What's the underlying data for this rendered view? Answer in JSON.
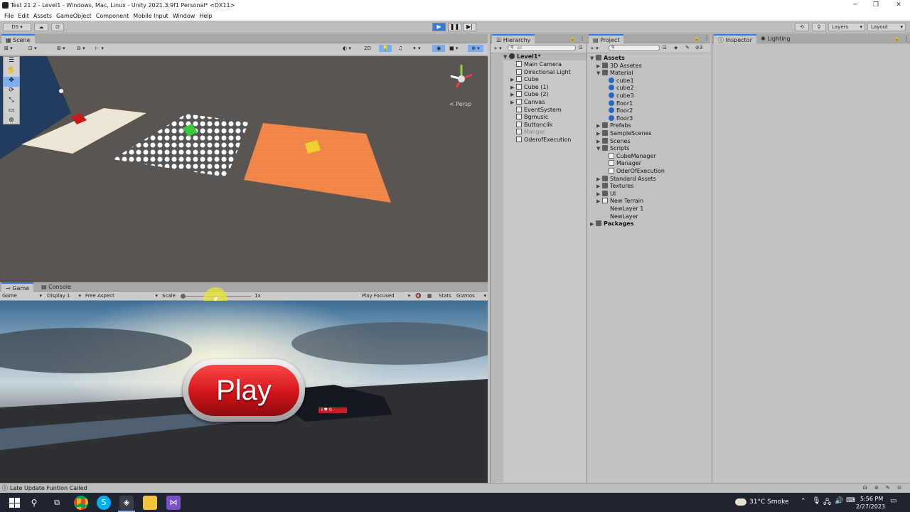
{
  "window": {
    "title": "Test 21 2 - Level1 - Windows, Mac, Linux - Unity 2021.3.9f1 Personal* <DX11>"
  },
  "menu": [
    "File",
    "Edit",
    "Assets",
    "GameObject",
    "Component",
    "Mobile Input",
    "Window",
    "Help"
  ],
  "toolbar": {
    "account": "DS",
    "layers": "Layers",
    "layout": "Layout"
  },
  "scene": {
    "tab": "Scene",
    "mode2d": "2D",
    "persp": "< Persp"
  },
  "game": {
    "tabs": [
      "Game",
      "Console"
    ],
    "mode": "Game",
    "display": "Display 1",
    "aspect": "Free Aspect",
    "scale_label": "Scale",
    "scale_value": "1x",
    "play_focused": "Play Focused",
    "stats": "Stats",
    "gizmos": "Gizmos",
    "play_button": "Play",
    "car_plate": "I ♥ 0"
  },
  "hierarchy": {
    "tab": "Hierarchy",
    "search_placeholder": "All",
    "root": "Level1*",
    "items": [
      {
        "label": "Main Camera",
        "arrow": ""
      },
      {
        "label": "Directional Light",
        "arrow": ""
      },
      {
        "label": "Cube",
        "arrow": "▶"
      },
      {
        "label": "Cube (1)",
        "arrow": "▶"
      },
      {
        "label": "Cube (2)",
        "arrow": "▶"
      },
      {
        "label": "Canvas",
        "arrow": "▶"
      },
      {
        "label": "EventSystem",
        "arrow": ""
      },
      {
        "label": "Bgmusic",
        "arrow": ""
      },
      {
        "label": "Buttonclik",
        "arrow": ""
      },
      {
        "label": "Manger",
        "arrow": "",
        "disabled": true
      },
      {
        "label": "OderofExecution",
        "arrow": ""
      }
    ]
  },
  "project": {
    "tab": "Project",
    "count": "3",
    "tree": [
      {
        "label": "Assets",
        "arrow": "▼",
        "icon": "fold",
        "bold": true,
        "indent": 0
      },
      {
        "label": "3D Assetes",
        "arrow": "▶",
        "icon": "fold",
        "indent": 1
      },
      {
        "label": "Material",
        "arrow": "▼",
        "icon": "fold",
        "indent": 1
      },
      {
        "label": "cube1",
        "arrow": "",
        "icon": "mat",
        "indent": 2
      },
      {
        "label": "cube2",
        "arrow": "",
        "icon": "mat",
        "indent": 2
      },
      {
        "label": "cube3",
        "arrow": "",
        "icon": "mat",
        "indent": 2
      },
      {
        "label": "floor1",
        "arrow": "",
        "icon": "mat",
        "indent": 2
      },
      {
        "label": "floor2",
        "arrow": "",
        "icon": "mat",
        "indent": 2
      },
      {
        "label": "floor3",
        "arrow": "",
        "icon": "mat",
        "indent": 2
      },
      {
        "label": "Prefabs",
        "arrow": "▶",
        "icon": "fold",
        "indent": 1
      },
      {
        "label": "SampleScenes",
        "arrow": "▶",
        "icon": "fold",
        "indent": 1
      },
      {
        "label": "Scenes",
        "arrow": "▶",
        "icon": "fold",
        "indent": 1
      },
      {
        "label": "Scripts",
        "arrow": "▼",
        "icon": "fold",
        "indent": 1
      },
      {
        "label": "CubeManager",
        "arrow": "",
        "icon": "sc",
        "indent": 2
      },
      {
        "label": "Manager",
        "arrow": "",
        "icon": "sc",
        "indent": 2
      },
      {
        "label": "OderOfExecution",
        "arrow": "",
        "icon": "sc",
        "indent": 2
      },
      {
        "label": "Standard Assets",
        "arrow": "▶",
        "icon": "fold",
        "indent": 1
      },
      {
        "label": "Textures",
        "arrow": "▶",
        "icon": "fold",
        "indent": 1
      },
      {
        "label": "UI",
        "arrow": "▶",
        "icon": "fold",
        "indent": 1
      },
      {
        "label": "New Terrain",
        "arrow": "▶",
        "icon": "go",
        "indent": 1
      },
      {
        "label": "NewLayer 1",
        "arrow": "",
        "icon": "",
        "indent": 1
      },
      {
        "label": "NewLayer",
        "arrow": "",
        "icon": "",
        "indent": 1
      },
      {
        "label": "Packages",
        "arrow": "▶",
        "icon": "fold",
        "bold": true,
        "indent": 0
      }
    ]
  },
  "inspector": {
    "tabs": [
      "Inspector",
      "Lighting"
    ]
  },
  "status": {
    "message": "Late Update Funtion Called"
  },
  "taskbar": {
    "weather": "31°C  Smoke",
    "time": "5:56 PM",
    "date": "2/27/2023"
  },
  "colors": {
    "accent": "#3a7ad6",
    "play_red": "#d0141a"
  }
}
